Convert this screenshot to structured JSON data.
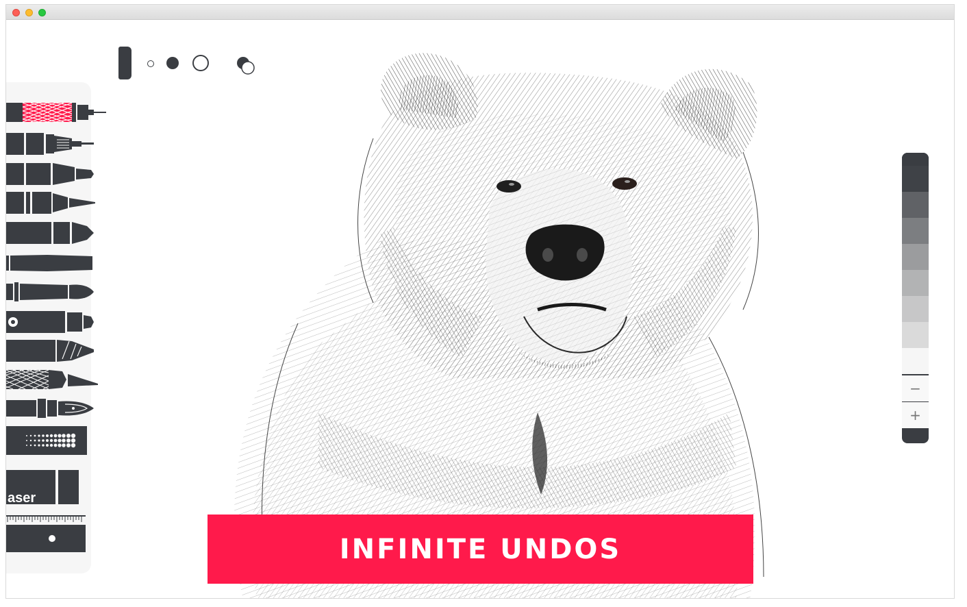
{
  "banner": {
    "text": "INFINITE UNDOS"
  },
  "tools": [
    {
      "name": "technical-pen",
      "accent": "#ff1a4b"
    },
    {
      "name": "fineliner"
    },
    {
      "name": "marker"
    },
    {
      "name": "fine-pencil"
    },
    {
      "name": "thick-marker"
    },
    {
      "name": "flat-brush"
    },
    {
      "name": "round-brush"
    },
    {
      "name": "airbrush"
    },
    {
      "name": "chisel-brush"
    },
    {
      "name": "crayon"
    },
    {
      "name": "fountain-pen"
    },
    {
      "name": "dot-pattern"
    },
    {
      "name": "eraser",
      "label": "aser"
    },
    {
      "name": "ruler"
    }
  ],
  "brush_sizes": [
    "small",
    "medium",
    "large"
  ],
  "palette": {
    "colors": [
      "#3a3d42",
      "#3f4247",
      "#606266",
      "#7c7e81",
      "#9b9c9e",
      "#b2b3b4",
      "#c7c7c8",
      "#dadada",
      "#ebebeb",
      "#f6f6f6"
    ],
    "minus_label": "−",
    "plus_label": "+"
  },
  "colors": {
    "accent": "#ff1a4b",
    "ui_dark": "#3a3d42"
  }
}
